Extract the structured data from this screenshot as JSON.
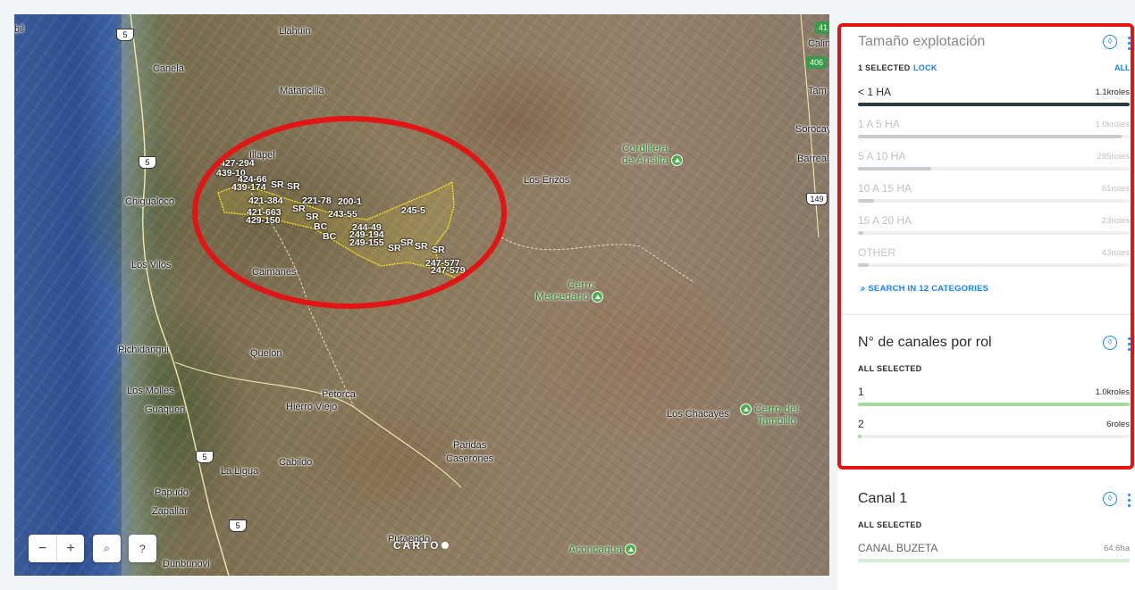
{
  "map": {
    "places": {
      "llahuin": "Llahuin",
      "canela": "Canela",
      "matancilla": "Matancilla",
      "illapel": "Illapel",
      "chigualoco": "Chigualoco",
      "los_vilos": "Los Vilos",
      "caimanes": "Caimanes",
      "los_erizos": "Los Erizos",
      "pichidangui": "Pichidangui",
      "quelon": "Quelon",
      "los_molles": "Los Molles",
      "guaquen": "Guaquen",
      "petorca": "Petorca",
      "hierro_viejo": "Hierro Viejo",
      "paridas": "Paridas",
      "caserones": "Caserones",
      "la_ligua": "La Ligua",
      "cabildo": "Cabildo",
      "papudo": "Papudo",
      "zapallar": "Zapallar",
      "dunbunovi": "Dunbunovi",
      "putaendo": "Putaendo",
      "los_chacayes": "Los Chacayes",
      "cordillera_line1": "Cordillera",
      "cordillera_line2": "de Ansilta",
      "cerro_mercedario_line1": "Cerro",
      "cerro_mercedario_line2": "Mercedario",
      "cerro_tambillo_line1": "Cerro del",
      "cerro_tambillo_line2": "Tambillo",
      "aconcagua": "Aconcagua",
      "calin": "Calin",
      "tam": "Tam",
      "sorocay": "Sorocay",
      "barreal": "Barreal",
      "bil": "bil"
    },
    "roads": {
      "r5_a": "5",
      "r5_b": "5",
      "r5_c": "5",
      "r5_d": "5",
      "r149": "149",
      "r406": "406",
      "r41": "41"
    },
    "parcel_labels": [
      "427-294",
      "439-10",
      "424-66",
      "439-174",
      "SR",
      "SR",
      "421-384",
      "221-78",
      "200-1",
      "SR",
      "421-663",
      "429-150",
      "SR",
      "243-55",
      "245-5",
      "BC",
      "BC",
      "244-49",
      "249-194",
      "249-155",
      "SR",
      "SR",
      "SR",
      "SR",
      "247-577",
      "247-579"
    ],
    "attribution": "CARTO",
    "controls": {
      "zoom_out": "−",
      "zoom_in": "+",
      "search": "⌕",
      "help": "?"
    }
  },
  "sidebar": {
    "widget1": {
      "title": "Tamaño explotación",
      "status": "1 SELECTED",
      "lock": "LOCK",
      "all": "ALL",
      "categories": [
        {
          "name": "< 1 HA",
          "value": "1.1kroles",
          "fraction": 1.0,
          "selected": true
        },
        {
          "name": "1 A 5 HA",
          "value": "1.0kroles",
          "fraction": 0.97,
          "selected": false
        },
        {
          "name": "5 A 10 HA",
          "value": "285roles",
          "fraction": 0.27,
          "selected": false
        },
        {
          "name": "10 A 15 HA",
          "value": "61roles",
          "fraction": 0.06,
          "selected": false
        },
        {
          "name": "15 A 20 HA",
          "value": "23roles",
          "fraction": 0.02,
          "selected": false
        },
        {
          "name": "OTHER",
          "value": "43roles",
          "fraction": 0.04,
          "selected": false
        }
      ],
      "search": "SEARCH IN 12 CATEGORIES"
    },
    "widget2": {
      "title": "N° de canales por rol",
      "status": "ALL SELECTED",
      "categories": [
        {
          "name": "1",
          "value": "1.0kroles",
          "fraction": 1.0
        },
        {
          "name": "2",
          "value": "6roles",
          "fraction": 0.01
        }
      ]
    },
    "widget3": {
      "title": "Canal 1",
      "status": "ALL SELECTED",
      "categories": [
        {
          "name": "CANAL BUZETA",
          "value": "64.6ha",
          "fraction": 1.0
        }
      ]
    }
  },
  "colors": {
    "accent": "#1785fb",
    "selected_bar": "#2c3a40",
    "unselected_bar": "#c9cccf",
    "green_bar": "#a6dba0",
    "annotation": "#e31414"
  }
}
